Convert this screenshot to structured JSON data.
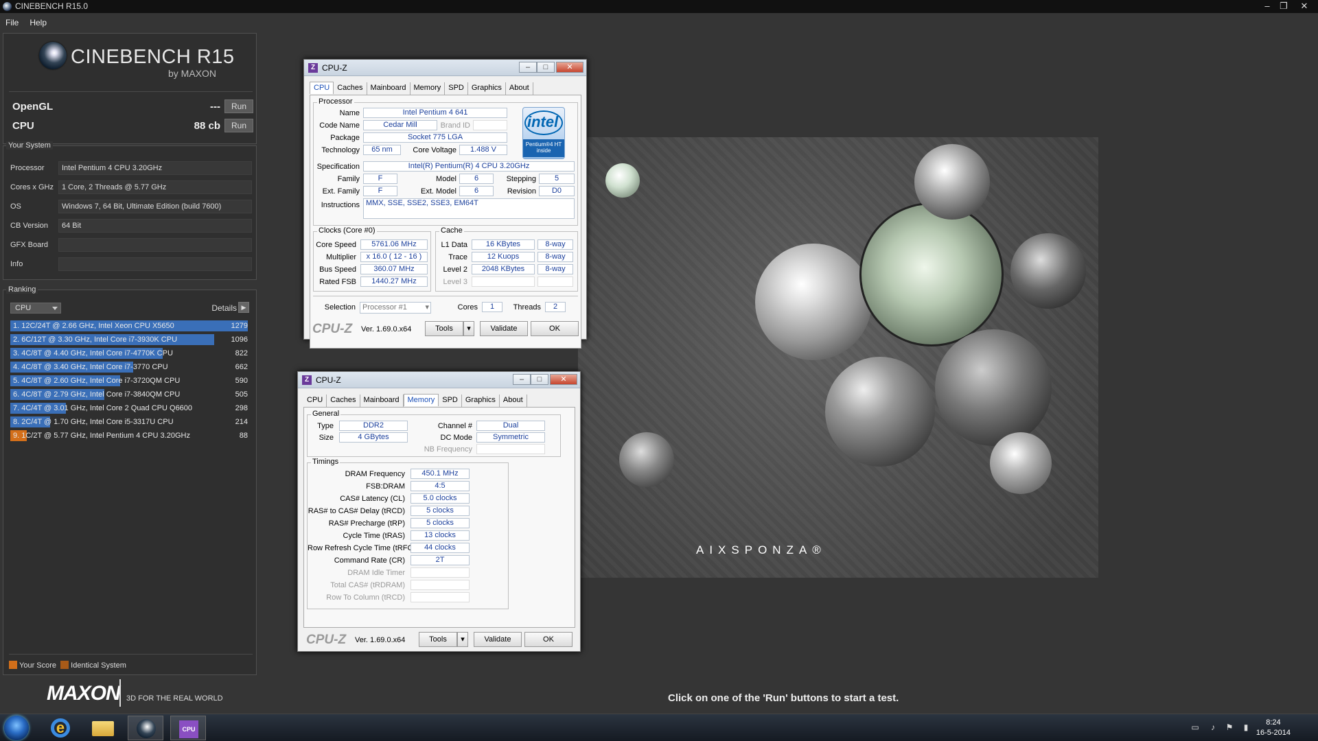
{
  "window": {
    "title": "CINEBENCH R15.0",
    "min": "–",
    "max": "❐",
    "close": "✕"
  },
  "menu": [
    "File",
    "Help"
  ],
  "logo": {
    "name": "CINEBENCH R15",
    "by": "by MAXON"
  },
  "bench": [
    {
      "label": "OpenGL",
      "value": "---",
      "button": "Run"
    },
    {
      "label": "CPU",
      "value": "88 cb",
      "button": "Run"
    }
  ],
  "system": {
    "title": "Your System",
    "rows": [
      {
        "key": "Processor",
        "value": "Intel Pentium 4 CPU 3.20GHz"
      },
      {
        "key": "Cores x GHz",
        "value": "1 Core, 2 Threads @ 5.77 GHz"
      },
      {
        "key": "OS",
        "value": "Windows 7, 64 Bit, Ultimate Edition (build 7600)"
      },
      {
        "key": "CB Version",
        "value": "64 Bit"
      },
      {
        "key": "GFX Board",
        "value": ""
      },
      {
        "key": "Info",
        "value": ""
      }
    ]
  },
  "ranking": {
    "title": "Ranking",
    "dropdown": "CPU",
    "details": "Details",
    "rows": [
      {
        "text": "1. 12C/24T @ 2.66 GHz, Intel Xeon CPU X5650",
        "score": "1279",
        "pct": 1.0,
        "me": false
      },
      {
        "text": "2. 6C/12T @ 3.30 GHz,  Intel Core i7-3930K CPU",
        "score": "1096",
        "pct": 0.857,
        "me": false
      },
      {
        "text": "3. 4C/8T @ 4.40 GHz, Intel Core i7-4770K CPU",
        "score": "822",
        "pct": 0.643,
        "me": false
      },
      {
        "text": "4. 4C/8T @ 3.40 GHz,  Intel Core i7-3770 CPU",
        "score": "662",
        "pct": 0.518,
        "me": false
      },
      {
        "text": "5. 4C/8T @ 2.60 GHz, Intel Core i7-3720QM CPU",
        "score": "590",
        "pct": 0.461,
        "me": false
      },
      {
        "text": "6. 4C/8T @ 2.79 GHz,  Intel Core i7-3840QM CPU",
        "score": "505",
        "pct": 0.395,
        "me": false
      },
      {
        "text": "7. 4C/4T @ 3.01 GHz, Intel Core 2 Quad CPU Q6600",
        "score": "298",
        "pct": 0.233,
        "me": false
      },
      {
        "text": "8. 2C/4T @ 1.70 GHz,  Intel Core i5-3317U CPU",
        "score": "214",
        "pct": 0.167,
        "me": false
      },
      {
        "text": "9. 1C/2T @ 5.77 GHz,  Intel Pentium 4 CPU 3.20GHz",
        "score": "88",
        "pct": 0.069,
        "me": true
      }
    ],
    "legend_your": "Your Score",
    "legend_identical": "Identical System",
    "color_bar": "#3a6fb8",
    "color_me": "#d36f1a",
    "color_identical": "#a85a18"
  },
  "footer": {
    "brand": "MAXON",
    "tagline": "3D FOR THE REAL WORLD",
    "status": "Click on one of the 'Run' buttons to start a test."
  },
  "render": {
    "watermark": "AIXSPONZA®"
  },
  "cpuz1": {
    "title": "CPU-Z",
    "tabs": [
      "CPU",
      "Caches",
      "Mainboard",
      "Memory",
      "SPD",
      "Graphics",
      "About"
    ],
    "active_tab": "CPU",
    "processor_group": "Processor",
    "name_lbl": "Name",
    "name": "Intel Pentium 4 641",
    "code_lbl": "Code Name",
    "code": "Cedar Mill",
    "brand_lbl": "Brand ID",
    "brand": "",
    "pkg_lbl": "Package",
    "pkg": "Socket 775 LGA",
    "tech_lbl": "Technology",
    "tech": "65 nm",
    "volt_lbl": "Core Voltage",
    "volt": "1.488 V",
    "spec_lbl": "Specification",
    "spec": "Intel(R) Pentium(R) 4 CPU 3.20GHz",
    "fam_lbl": "Family",
    "fam": "F",
    "model_lbl": "Model",
    "model": "6",
    "step_lbl": "Stepping",
    "step": "5",
    "efam_lbl": "Ext. Family",
    "efam": "F",
    "emodel_lbl": "Ext. Model",
    "emodel": "6",
    "rev_lbl": "Revision",
    "rev": "D0",
    "instr_lbl": "Instructions",
    "instr": "MMX, SSE, SSE2, SSE3, EM64T",
    "intel_logo": "intel",
    "intel_sub": "Pentium®4 HT inside",
    "clocks_group": "Clocks (Core #0)",
    "cs_lbl": "Core Speed",
    "cs": "5761.06 MHz",
    "mul_lbl": "Multiplier",
    "mul": "x 16.0 ( 12 - 16 )",
    "bus_lbl": "Bus Speed",
    "bus": "360.07 MHz",
    "fsb_lbl": "Rated FSB",
    "fsb": "1440.27 MHz",
    "cache_group": "Cache",
    "l1_lbl": "L1 Data",
    "l1": "16 KBytes",
    "l1w": "8-way",
    "tr_lbl": "Trace",
    "tr": "12 Kuops",
    "trw": "8-way",
    "l2_lbl": "Level 2",
    "l2": "2048 KBytes",
    "l2w": "8-way",
    "l3_lbl": "Level 3",
    "l3": "",
    "l3w": "",
    "sel_lbl": "Selection",
    "sel": "Processor #1",
    "cores_lbl": "Cores",
    "cores": "1",
    "thr_lbl": "Threads",
    "thr": "2",
    "brand_mark": "CPU-Z",
    "version": "Ver. 1.69.0.x64",
    "tools": "Tools",
    "validate": "Validate",
    "ok": "OK"
  },
  "cpuz2": {
    "title": "CPU-Z",
    "tabs": [
      "CPU",
      "Caches",
      "Mainboard",
      "Memory",
      "SPD",
      "Graphics",
      "About"
    ],
    "active_tab": "Memory",
    "general_group": "General",
    "type_lbl": "Type",
    "type": "DDR2",
    "size_lbl": "Size",
    "size": "4 GBytes",
    "ch_lbl": "Channel #",
    "ch": "Dual",
    "dc_lbl": "DC Mode",
    "dc": "Symmetric",
    "nb_lbl": "NB Frequency",
    "nb": "",
    "timings_group": "Timings",
    "timings": [
      {
        "k": "DRAM Frequency",
        "v": "450.1 MHz",
        "dis": false
      },
      {
        "k": "FSB:DRAM",
        "v": "4:5",
        "dis": false
      },
      {
        "k": "CAS# Latency (CL)",
        "v": "5.0 clocks",
        "dis": false
      },
      {
        "k": "RAS# to CAS# Delay (tRCD)",
        "v": "5 clocks",
        "dis": false
      },
      {
        "k": "RAS# Precharge (tRP)",
        "v": "5 clocks",
        "dis": false
      },
      {
        "k": "Cycle Time (tRAS)",
        "v": "13 clocks",
        "dis": false
      },
      {
        "k": "Row Refresh Cycle Time (tRFC)",
        "v": "44 clocks",
        "dis": false
      },
      {
        "k": "Command Rate (CR)",
        "v": "2T",
        "dis": false
      },
      {
        "k": "DRAM Idle Timer",
        "v": "",
        "dis": true
      },
      {
        "k": "Total CAS# (tRDRAM)",
        "v": "",
        "dis": true
      },
      {
        "k": "Row To Column (tRCD)",
        "v": "",
        "dis": true
      }
    ],
    "brand_mark": "CPU-Z",
    "version": "Ver. 1.69.0.x64",
    "tools": "Tools",
    "validate": "Validate",
    "ok": "OK"
  },
  "taskbar": {
    "time": "8:24",
    "date": "16-5-2014",
    "apps": [
      "ie-icon",
      "explorer-icon",
      "cinebench-icon",
      "cpuz-icon"
    ]
  }
}
